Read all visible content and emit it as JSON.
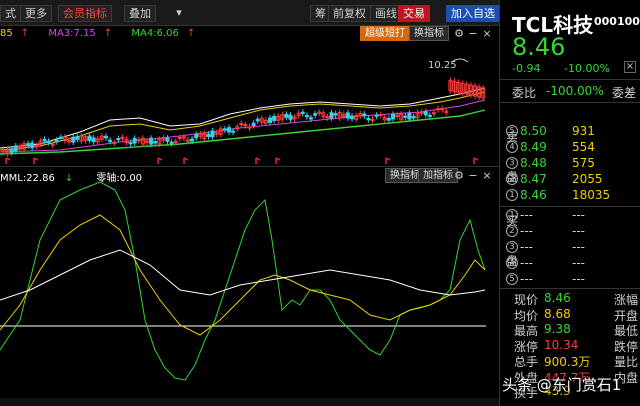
{
  "toolbar": {
    "items": [
      "式",
      "更多",
      "会员指标",
      "叠加",
      "筹",
      "前复权",
      "画线",
      "交易",
      "加入自选"
    ]
  },
  "upper_chart": {
    "ma_legend": [
      {
        "text": "85",
        "arrow": "↑",
        "color": "#f0d000"
      },
      {
        "text": "MA3:7.15",
        "arrow": "↑",
        "color": "#e040e0"
      },
      {
        "text": "MA4:6.06",
        "arrow": "↑",
        "color": "#33d633"
      }
    ],
    "super_button": "超级短打",
    "switch_button": "换指标",
    "high_label": "10.25"
  },
  "lower_chart": {
    "legend": [
      {
        "text": "MML:22.86",
        "arrow": "↓",
        "color": "#ffffff"
      },
      {
        "text": "零轴:0.00",
        "arrow": "",
        "color": "#ffffff"
      }
    ],
    "switch_button": "换指标",
    "add_button": "加指标"
  },
  "quote": {
    "name": "TCL科技",
    "code": "000100",
    "price": "8.46",
    "change_abs": "-0.94",
    "change_pct": "-10.00%",
    "weibi_label": "委比",
    "weibi_value": "-100.00%",
    "weicha_label": "委差",
    "sell_label": [
      "卖",
      "盘"
    ],
    "buy_label": [
      "买",
      "盘"
    ],
    "sell_levels": [
      {
        "idx": "5",
        "price": "8.50",
        "vol": "931"
      },
      {
        "idx": "4",
        "price": "8.49",
        "vol": "554"
      },
      {
        "idx": "3",
        "price": "8.48",
        "vol": "575"
      },
      {
        "idx": "2",
        "price": "8.47",
        "vol": "2055"
      },
      {
        "idx": "1",
        "price": "8.46",
        "vol": "18035"
      }
    ],
    "buy_levels": [
      {
        "idx": "1",
        "price": "---",
        "vol": "---"
      },
      {
        "idx": "2",
        "price": "---",
        "vol": "---"
      },
      {
        "idx": "3",
        "price": "---",
        "vol": "---"
      },
      {
        "idx": "4",
        "price": "---",
        "vol": "---"
      },
      {
        "idx": "5",
        "price": "---",
        "vol": "---"
      }
    ],
    "stats": [
      {
        "label": "现价",
        "value": "8.46",
        "color": "green",
        "label2": "涨幅"
      },
      {
        "label": "均价",
        "value": "8.68",
        "color": "yellow",
        "label2": "开盘"
      },
      {
        "label": "最高",
        "value": "9.38",
        "color": "green",
        "label2": "最低"
      },
      {
        "label": "涨停",
        "value": "10.34",
        "color": "red",
        "label2": "跌停"
      },
      {
        "label": "总手",
        "value": "900.3万",
        "color": "yellow",
        "label2": "量比"
      },
      {
        "label": "外盘",
        "value": "447.7万",
        "color": "red",
        "label2": "内盘"
      },
      {
        "label": "换手",
        "value": "43.9",
        "color": "yellow",
        "label2": ""
      }
    ]
  },
  "watermark": "头条 @东门赏石1"
}
